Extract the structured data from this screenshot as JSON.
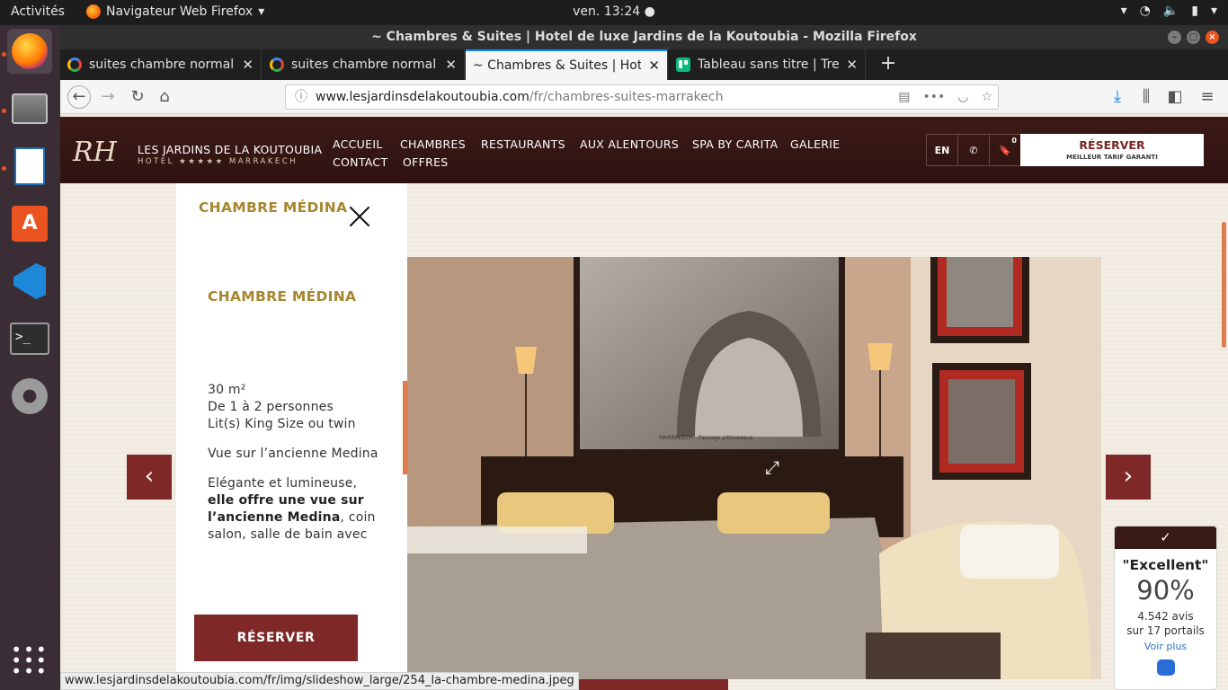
{
  "system": {
    "activities": "Activités",
    "app_menu": "Navigateur Web Firefox",
    "clock": "ven. 13:24"
  },
  "window": {
    "title": "~ Chambres & Suites | Hotel de luxe Jardins de la Koutoubia - Mozilla Firefox"
  },
  "tabs": [
    {
      "label": "suites chambre normal - ",
      "icon": "google-icon"
    },
    {
      "label": "suites chambre normal - ",
      "icon": "google-icon"
    },
    {
      "label": "~ Chambres & Suites | Hotel",
      "icon": ""
    },
    {
      "label": "Tableau sans titre | Trello",
      "icon": "trello-icon"
    }
  ],
  "navbar": {
    "url_domain": "www.lesjardinsdelakoutoubia.com",
    "url_path": "/fr/chambres-suites-marrakech"
  },
  "site": {
    "logo": "RH",
    "hotel_name": "LES JARDINS DE LA KOUTOUBIA",
    "hotel_sub": "HOTEL ★★★★★ MARRAKECH",
    "menu": [
      "ACCUEIL",
      "CHAMBRES",
      "RESTAURANTS",
      "AUX ALENTOURS",
      "SPA BY CARITA",
      "GALERIE",
      "CONTACT",
      "OFFRES"
    ],
    "lang": "EN",
    "cart_count": "0",
    "reserve_label": "RÉSERVER",
    "reserve_sub": "MEILLEUR TARIF GARANTI"
  },
  "panel": {
    "title": "CHAMBRE MÉDINA",
    "heading": "CHAMBRE MÉDINA",
    "area": "30 m²",
    "capacity": "De 1 à 2 personnes",
    "beds": "Lit(s) King Size ou twin",
    "view": "Vue sur l’ancienne Medina",
    "desc_1": "Elégante et lumineuse,",
    "desc_bold_1": "elle offre une vue sur",
    "desc_bold_2": "l’ancienne Medina",
    "desc_2": ", coin",
    "desc_3": "salon, salle de bain avec",
    "reserve": "RÉSERVER"
  },
  "image_caption": "MARRAKECH - Passage pittoresque",
  "review": {
    "rating": "\"Excellent\"",
    "percent": "90%",
    "count": "4.542 avis",
    "portals": "sur 17 portails",
    "more": "Voir plus"
  },
  "status_url": "www.lesjardinsdelakoutoubia.com/fr/img/slideshow_large/254_la-chambre-medina.jpeg",
  "colors": {
    "brand_dark": "#3c1a17",
    "brand_red": "#7e2828",
    "gold": "#a6872f",
    "ubuntu_orange": "#e95420"
  }
}
